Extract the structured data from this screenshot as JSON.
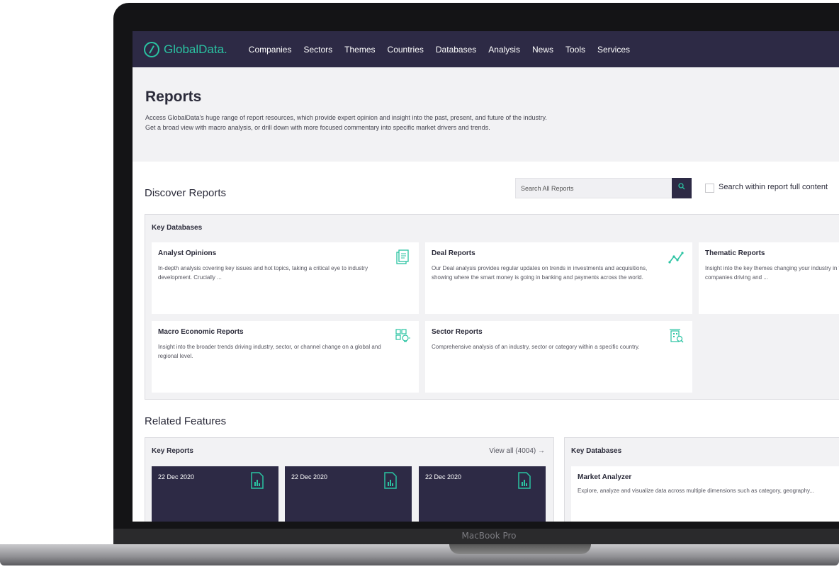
{
  "device": {
    "label": "MacBook Pro"
  },
  "nav": {
    "brand": "GlobalData.",
    "items": [
      "Companies",
      "Sectors",
      "Themes",
      "Countries",
      "Databases",
      "Analysis",
      "News",
      "Tools",
      "Services"
    ]
  },
  "header": {
    "title": "Reports",
    "desc_line1": "Access GlobalData's huge range of report resources, which provide expert opinion and insight into the past, present, and future of the industry.",
    "desc_line2": "Get a broad view with macro analysis, or drill down with more focused commentary into specific market drivers and trends."
  },
  "discover": {
    "title": "Discover Reports",
    "search_placeholder": "Search All Reports",
    "search_full_content_label": "Search within report full content"
  },
  "key_databases": {
    "title": "Key Databases",
    "cards": [
      {
        "title": "Analyst Opinions",
        "desc": "In-depth analysis covering key issues and hot topics, taking a critical eye to industry development. Crucially ...",
        "icon": "document-icon"
      },
      {
        "title": "Deal Reports",
        "desc": "Our Deal analysis provides regular updates on trends in investments and acquisitions, showing where the smart money is going in banking and payments across the world.",
        "icon": "trend-line-icon"
      },
      {
        "title": "Thematic Reports",
        "desc": "Insight into the key themes changing your industry in the short, medium and long term, and the companies driving and ...",
        "icon": "theme-icon"
      },
      {
        "title": "Macro Economic Reports",
        "desc": "Insight into the broader trends driving industry, sector, or channel change on a global and regional level.",
        "icon": "lightbulb-icon"
      },
      {
        "title": "Sector Reports",
        "desc": "Comprehensive analysis of an industry, sector or category within a specific country.",
        "icon": "building-search-icon"
      }
    ]
  },
  "related": {
    "title": "Related Features",
    "key_reports": {
      "title": "Key Reports",
      "view_all": "View all (4004) →",
      "items": [
        {
          "date": "22 Dec 2020"
        },
        {
          "date": "22 Dec 2020"
        },
        {
          "date": "22 Dec 2020"
        }
      ]
    },
    "key_databases": {
      "title": "Key Databases",
      "card": {
        "title": "Market Analyzer",
        "desc": "Explore, analyze and visualize data across multiple dimensions such as category, geography..."
      }
    }
  },
  "colors": {
    "brand": "#2d2a45",
    "accent": "#2ac3a2"
  }
}
